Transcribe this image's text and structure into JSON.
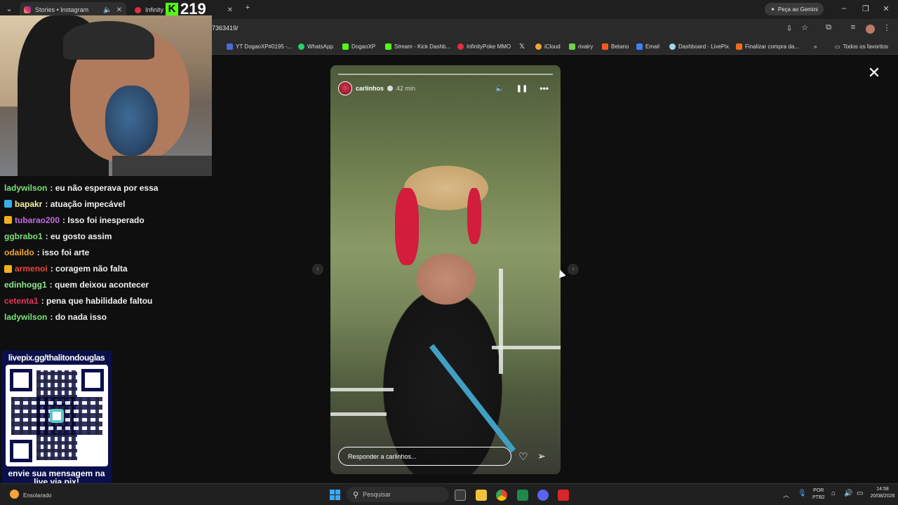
{
  "browser": {
    "tabs": [
      {
        "title": "Stories • Instagram",
        "active": true
      },
      {
        "title": "Infinity",
        "active": false
      }
    ],
    "new_tab": "+",
    "gemini_button": "Peça ao Gemini",
    "url_fragment": "7363419/",
    "bookmarks": [
      {
        "label": "YT DogaoXP#0195 -...",
        "color": "#4b6bd6"
      },
      {
        "label": "WhatsApp",
        "color": "#25d366"
      },
      {
        "label": "DogaoXP",
        "color": "#53fc18"
      },
      {
        "label": "Stream - Kick Dashb...",
        "color": "#53fc18"
      },
      {
        "label": "InfinityPoke MMO",
        "color": "#e0303f"
      },
      {
        "label": "",
        "color": "#e8e8e8"
      },
      {
        "label": "iCloud",
        "color": "#f2a33a"
      },
      {
        "label": "rivalry",
        "color": "#6fd14a"
      },
      {
        "label": "Betano",
        "color": "#ff5a1f"
      },
      {
        "label": "Email",
        "color": "#3b82f6"
      },
      {
        "label": "Dashboard - LivePix",
        "color": "#9fd8e8"
      },
      {
        "label": "Finalizar compra da...",
        "color": "#f26b1d"
      }
    ],
    "all_bookmarks": "Todos os favoritos"
  },
  "story": {
    "username": "carlinhos",
    "time_ago": "42 min",
    "reply_placeholder": "Responder a carlinhos..."
  },
  "stream": {
    "viewer_count": "219",
    "chat": [
      {
        "user": "ladywilson",
        "text": ": eu não esperava por essa",
        "color": "#7be07b",
        "badge": ""
      },
      {
        "user": "bapakr",
        "text": ": atuação impecável",
        "color": "#f2f2a0",
        "badge": "#3ab0e8"
      },
      {
        "user": "tubarao200",
        "text": ": Isso foi inesperado",
        "color": "#c46ce0",
        "badge": "#f2b01e"
      },
      {
        "user": "ggbrabo1",
        "text": ": eu gosto assim",
        "color": "#7be07b",
        "badge": ""
      },
      {
        "user": "odaildo",
        "text": ": isso foi arte",
        "color": "#f0a830",
        "badge": ""
      },
      {
        "user": "armenoi",
        "text": ": coragem não falta",
        "color": "#e8483a",
        "badge": "#f2b01e"
      },
      {
        "user": "edinhogg1",
        "text": ": quem deixou acontecer",
        "color": "#8fe88f",
        "badge": ""
      },
      {
        "user": "cetenta1",
        "text": ": pena que habilidade faltou",
        "color": "#e8365a",
        "badge": ""
      },
      {
        "user": "ladywilson",
        "text": ": do nada isso",
        "color": "#7be07b",
        "badge": ""
      }
    ],
    "qr": {
      "url": "livepix.gg/thalitondouglas",
      "caption": "envie sua mensagem na live via pix!"
    }
  },
  "taskbar": {
    "weather": "Ensolarado",
    "search_placeholder": "Pesquisar",
    "lang": "POR",
    "lang_sub": "PTB2",
    "time": "14:58",
    "date": "20/08/2026"
  }
}
